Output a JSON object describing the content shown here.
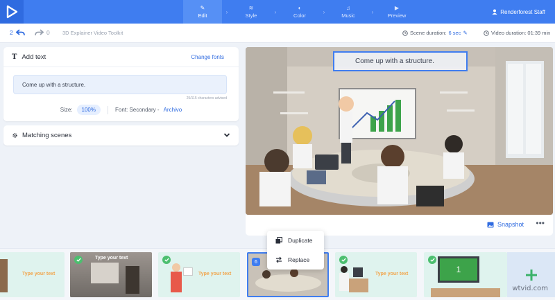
{
  "header": {
    "steps": [
      {
        "label": "Edit",
        "icon": "pencil-icon"
      },
      {
        "label": "Style",
        "icon": "layers-icon"
      },
      {
        "label": "Color",
        "icon": "palette-icon"
      },
      {
        "label": "Music",
        "icon": "music-icon"
      },
      {
        "label": "Preview",
        "icon": "play-icon"
      }
    ],
    "active_step": "Edit",
    "user_name": "Renderforest Staff"
  },
  "toolbar": {
    "undo_count": "2",
    "redo_count": "0",
    "project_name": "3D Explainer Video Toolkit",
    "scene_duration_label": "Scene duration:",
    "scene_duration_value": "6 sec",
    "video_duration_label": "Video duration: 01:39 min"
  },
  "add_text": {
    "title": "Add text",
    "change_fonts": "Change fonts",
    "text_value": "Come up with a structure.",
    "chars_advised": "25/115 characters advised",
    "size_label": "Size:",
    "size_value": "100%",
    "font_label": "Font: Secondary -",
    "font_name": "Archivo"
  },
  "matching": {
    "title": "Matching scenes"
  },
  "preview": {
    "caption": "Come up with a structure.",
    "snapshot_label": "Snapshot",
    "more_label": "•••"
  },
  "context_menu": {
    "duplicate": "Duplicate",
    "replace": "Replace"
  },
  "timeline": {
    "thumbs": [
      {
        "text": "Type your text"
      },
      {
        "text": "Type your text"
      },
      {
        "text": "Type your text"
      },
      {
        "number": "6"
      },
      {
        "text": "Type your text"
      },
      {
        "monitor_number": "1"
      }
    ]
  },
  "watermark": "wtvid.com",
  "colors": {
    "brand": "#3f7df0",
    "accent_text": "#2f6be0",
    "check": "#4cbf6f"
  }
}
